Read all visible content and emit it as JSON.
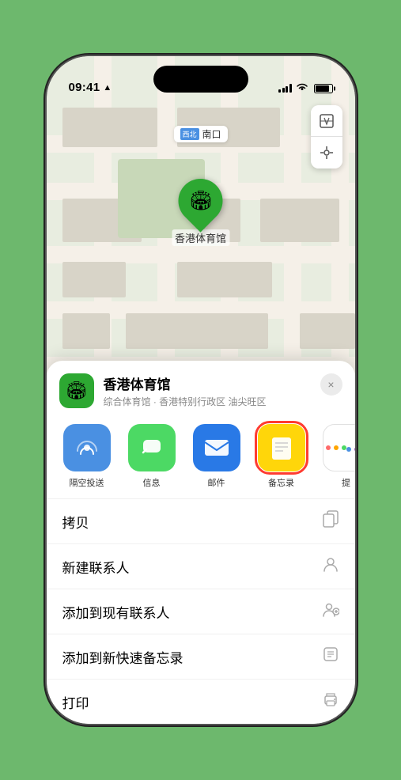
{
  "status": {
    "time": "09:41",
    "location_arrow": "▶"
  },
  "map": {
    "location_tag": "南口",
    "tag_prefix": "西北"
  },
  "venue": {
    "name": "香港体育馆",
    "subtitle": "综合体育馆 · 香港特别行政区 油尖旺区",
    "icon_emoji": "🏟"
  },
  "share_items": [
    {
      "id": "airdrop",
      "label": "隔空投送",
      "selected": false
    },
    {
      "id": "message",
      "label": "信息",
      "selected": false
    },
    {
      "id": "mail",
      "label": "邮件",
      "selected": false
    },
    {
      "id": "notes",
      "label": "备忘录",
      "selected": true
    },
    {
      "id": "more",
      "label": "提",
      "selected": false
    }
  ],
  "actions": [
    {
      "id": "copy",
      "label": "拷贝",
      "icon": "⊕"
    },
    {
      "id": "new-contact",
      "label": "新建联系人",
      "icon": "⊕"
    },
    {
      "id": "add-existing",
      "label": "添加到现有联系人",
      "icon": "⊕"
    },
    {
      "id": "add-note",
      "label": "添加到新快速备忘录",
      "icon": "⊕"
    },
    {
      "id": "print",
      "label": "打印",
      "icon": "⊕"
    }
  ],
  "close_label": "×"
}
